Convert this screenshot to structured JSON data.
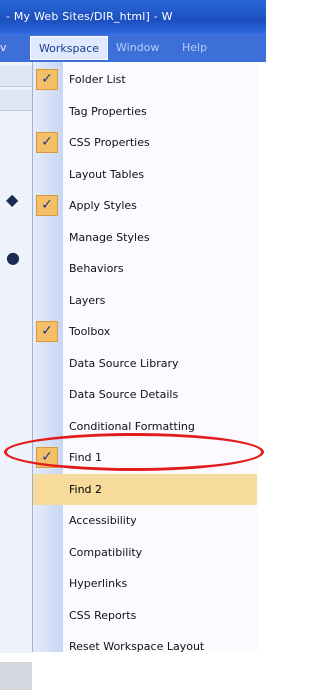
{
  "window": {
    "title": "- My Web Sites/DIR_html] - W"
  },
  "menubar": {
    "left_fragment": "v",
    "active_menu": "Workspace",
    "window_menu": "Window",
    "help_menu": "Help"
  },
  "menu": {
    "items": [
      {
        "label": "Folder List",
        "checked": true
      },
      {
        "label": "Tag Properties",
        "checked": false
      },
      {
        "label": "CSS Properties",
        "checked": true
      },
      {
        "label": "Layout Tables",
        "checked": false
      },
      {
        "label": "Apply Styles",
        "checked": true
      },
      {
        "label": "Manage Styles",
        "checked": false
      },
      {
        "label": "Behaviors",
        "checked": false
      },
      {
        "label": "Layers",
        "checked": false
      },
      {
        "label": "Toolbox",
        "checked": true
      },
      {
        "label": "Data Source Library",
        "checked": false
      },
      {
        "label": "Data Source Details",
        "checked": false
      },
      {
        "label": "Conditional Formatting",
        "checked": false
      },
      {
        "label": "Find 1",
        "checked": true
      },
      {
        "label": "Find 2",
        "checked": false,
        "highlighted": true
      },
      {
        "label": "Accessibility",
        "checked": false
      },
      {
        "label": "Compatibility",
        "checked": false
      },
      {
        "label": "Hyperlinks",
        "checked": false
      },
      {
        "label": "CSS Reports",
        "checked": false
      },
      {
        "label": "Reset Workspace Layout",
        "checked": false
      }
    ]
  },
  "colors": {
    "highlight": "#f6db9c",
    "check_background": "#f4bf68",
    "annotation": "#e21b1b"
  }
}
